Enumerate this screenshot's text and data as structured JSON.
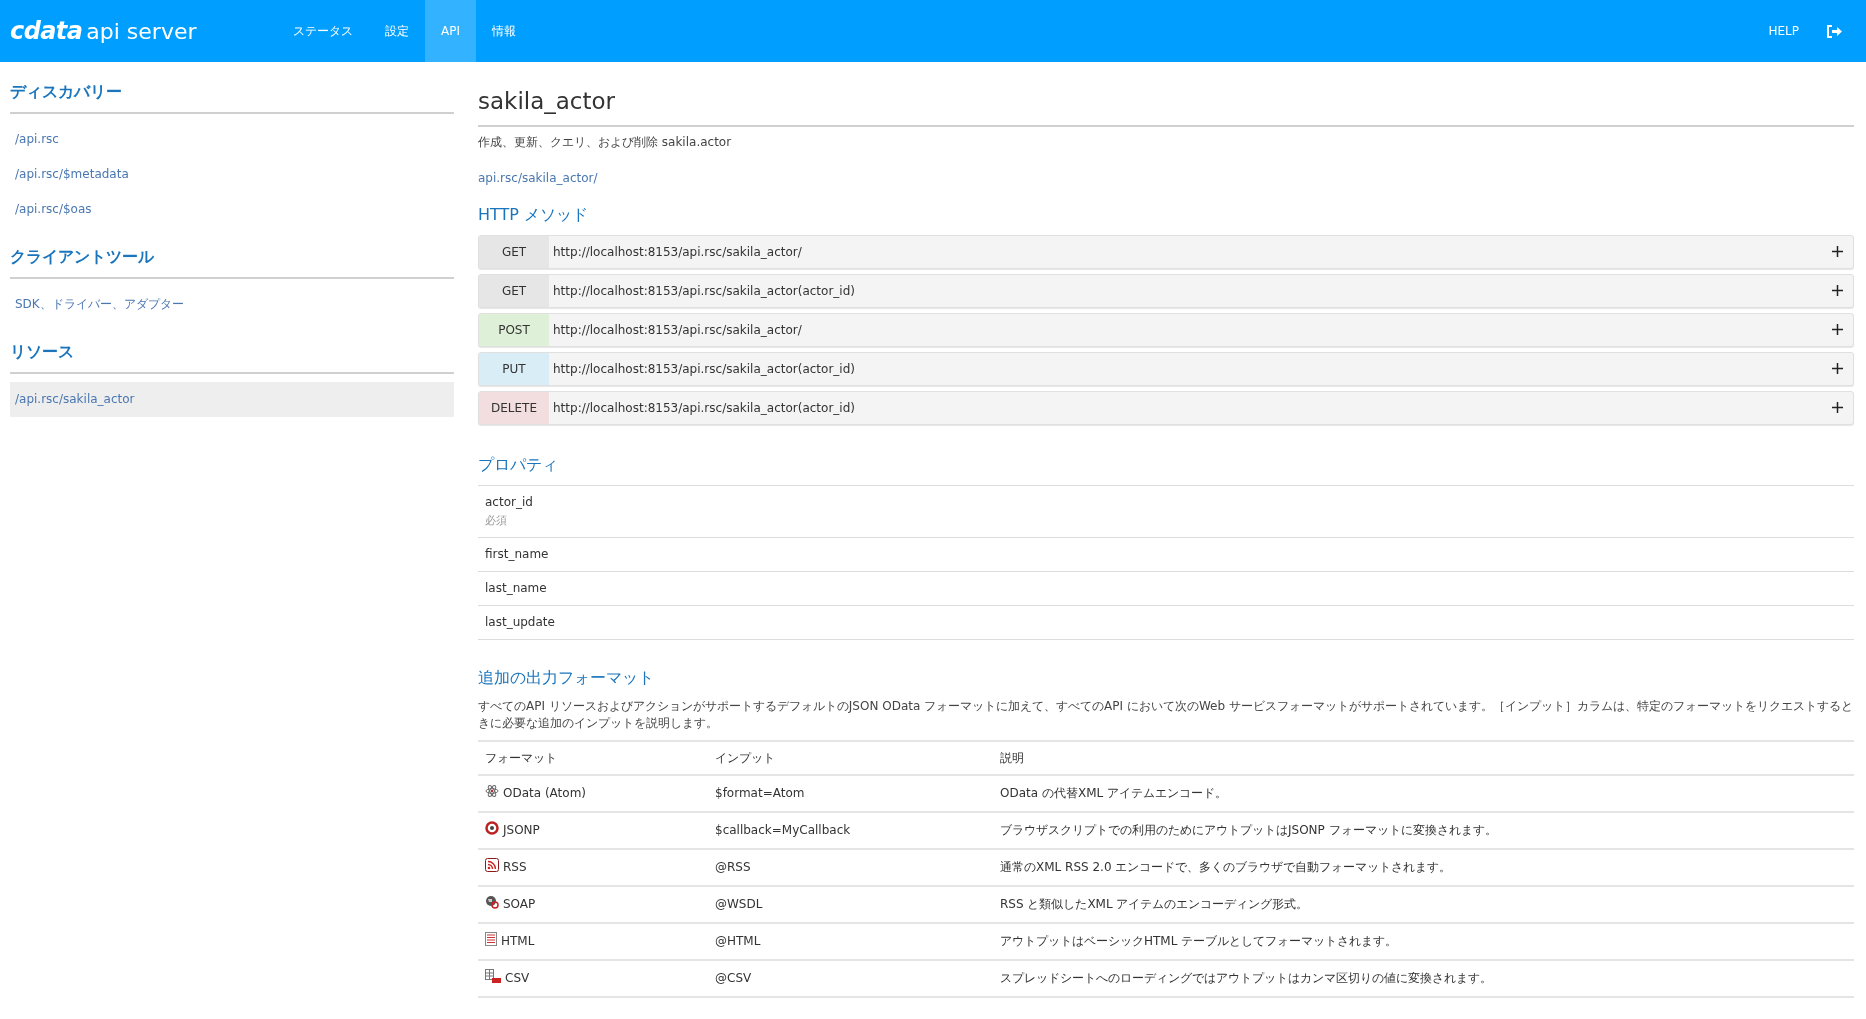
{
  "header": {
    "logo_brand": "cdata",
    "logo_product": "api server",
    "nav": [
      {
        "label": "ステータス",
        "selected": false
      },
      {
        "label": "設定",
        "selected": false
      },
      {
        "label": "API",
        "selected": true
      },
      {
        "label": "情報",
        "selected": false
      }
    ],
    "help": "HELP"
  },
  "sidebar": {
    "sections": [
      {
        "title": "ディスカバリー",
        "items": [
          {
            "label": "/api.rsc",
            "selected": false
          },
          {
            "label": "/api.rsc/$metadata",
            "selected": false
          },
          {
            "label": "/api.rsc/$oas",
            "selected": false
          }
        ]
      },
      {
        "title": "クライアントツール",
        "items": [
          {
            "label": "SDK、ドライバー、アダプター",
            "selected": false
          }
        ]
      },
      {
        "title": "リソース",
        "items": [
          {
            "label": "/api.rsc/sakila_actor",
            "selected": true
          }
        ]
      }
    ]
  },
  "main": {
    "title": "sakila_actor",
    "description": "作成、更新、クエリ、および削除 sakila.actor",
    "link": "api.rsc/sakila_actor/",
    "methods_title": "HTTP メソッド",
    "methods": [
      {
        "method": "GET",
        "color": "#e6e6e6",
        "url": "http://localhost:8153/api.rsc/sakila_actor/"
      },
      {
        "method": "GET",
        "color": "#e6e6e6",
        "url": "http://localhost:8153/api.rsc/sakila_actor(actor_id)"
      },
      {
        "method": "POST",
        "color": "#dff0d8",
        "url": "http://localhost:8153/api.rsc/sakila_actor/"
      },
      {
        "method": "PUT",
        "color": "#d9edf7",
        "url": "http://localhost:8153/api.rsc/sakila_actor(actor_id)"
      },
      {
        "method": "DELETE",
        "color": "#f2dede",
        "url": "http://localhost:8153/api.rsc/sakila_actor(actor_id)"
      }
    ],
    "properties_title": "プロパティ",
    "properties": [
      {
        "name": "actor_id",
        "note": "必須"
      },
      {
        "name": "first_name"
      },
      {
        "name": "last_name"
      },
      {
        "name": "last_update"
      }
    ],
    "formats_title": "追加の出力フォーマット",
    "formats_description": "すべてのAPI リソースおよびアクションがサポートするデフォルトのJSON OData フォーマットに加えて、すべてのAPI において次のWeb サービスフォーマットがサポートされています。［インプット］カラムは、特定のフォーマットをリクエストするときに必要な追加のインプットを説明します。",
    "formats_table": {
      "columns": [
        "フォーマット",
        "インプット",
        "説明"
      ],
      "rows": [
        {
          "kind": "atom",
          "format": "OData (Atom)",
          "input": "$format=Atom",
          "description": "OData の代替XML アイテムエンコード。"
        },
        {
          "kind": "jsonp",
          "format": "JSONP",
          "input": "$callback=MyCallback",
          "description": "ブラウザスクリプトでの利用のためにアウトプットはJSONP フォーマットに変換されます。"
        },
        {
          "kind": "rss",
          "format": "RSS",
          "input": "@RSS",
          "description": "通常のXML RSS 2.0 エンコードで、多くのブラウザで自動フォーマットされます。"
        },
        {
          "kind": "soap",
          "format": "SOAP",
          "input": "@WSDL",
          "description": "RSS と類似したXML アイテムのエンコーディング形式。"
        },
        {
          "kind": "html",
          "format": "HTML",
          "input": "@HTML",
          "description": "アウトプットはベーシックHTML テーブルとしてフォーマットされます。"
        },
        {
          "kind": "csv",
          "format": "CSV",
          "input": "@CSV",
          "description": "スプレッドシートへのローディングではアウトプットはカンマ区切りの値に変換されます。"
        }
      ]
    }
  }
}
